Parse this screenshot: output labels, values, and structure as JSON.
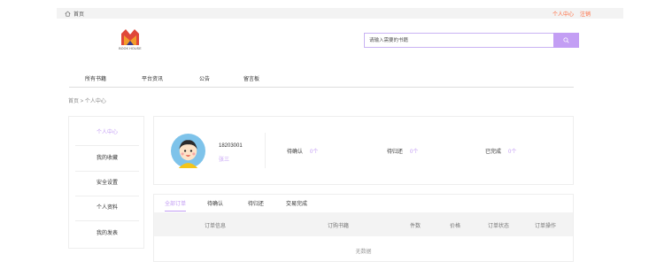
{
  "topbar": {
    "home_label": "首页",
    "user_center": "个人中心",
    "logout": "注销"
  },
  "logo": {
    "text": "BOOK HOUSE"
  },
  "search": {
    "placeholder": "请输入需要的书籍"
  },
  "nav": {
    "items": [
      "所有书籍",
      "平台资讯",
      "公告",
      "留言板"
    ]
  },
  "breadcrumb": "首页 > 个人中心",
  "sidebar": {
    "items": [
      {
        "label": "个人中心",
        "active": true
      },
      {
        "label": "我的收藏"
      },
      {
        "label": "安全设置"
      },
      {
        "label": "个人资料"
      },
      {
        "label": "我的发表"
      }
    ]
  },
  "profile": {
    "user_id": "18203001",
    "user_name": "张三",
    "stats": [
      {
        "label": "待确认",
        "value": "0个"
      },
      {
        "label": "待归还",
        "value": "0个"
      },
      {
        "label": "已完成",
        "value": "0个"
      }
    ]
  },
  "orders": {
    "tabs": [
      "全部订单",
      "待确认",
      "待归还",
      "交易完成"
    ],
    "columns": [
      "订单信息",
      "订购书籍",
      "件数",
      "价格",
      "订单状态",
      "订单操作"
    ],
    "empty_text": "无数据"
  },
  "colors": {
    "accent": "#c39ef4",
    "link": "#ff6a3d",
    "panel_bg": "#f3f3f3"
  }
}
